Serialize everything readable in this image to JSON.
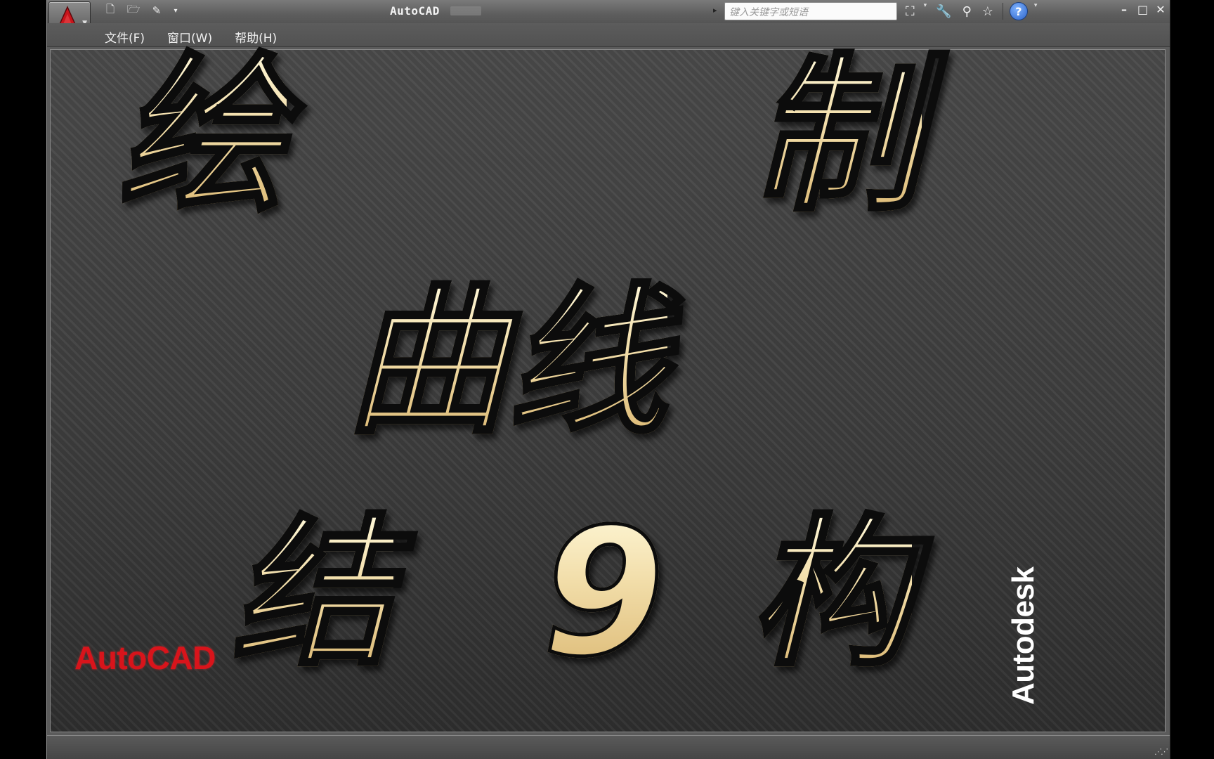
{
  "window": {
    "title": "AutoCAD",
    "quick_access": [
      {
        "icon": "new-file-icon",
        "glyph": "🗋"
      },
      {
        "icon": "open-folder-icon",
        "glyph": "🗁"
      },
      {
        "icon": "save-icon",
        "glyph": "✎"
      },
      {
        "icon": "customize-dropdown-icon",
        "glyph": "▾"
      }
    ],
    "search_placeholder": "键入关键字或短语",
    "controls": {
      "minimize": "–",
      "maximize": "□",
      "close": "✕"
    }
  },
  "menu": {
    "items": [
      "文件(F)",
      "窗口(W)",
      "帮助(H)"
    ]
  },
  "toolbar_right": {
    "search_arrow": "▸",
    "binoculars": "⛶",
    "wrench": "🔧",
    "satellite": "⚲",
    "star": "☆",
    "help": "?",
    "dropdown": "▾"
  },
  "splash": {
    "chars": [
      "绘",
      "制",
      "曲线",
      "结",
      "9",
      "构"
    ],
    "brand_left": "AutoCAD",
    "brand_right": "Autodesk"
  },
  "status": {
    "grip": "⋰⋰"
  },
  "colors": {
    "text_gold": "#f1dca7",
    "brand_red": "#d8141b",
    "chrome_gray": "#5b5b5b"
  }
}
